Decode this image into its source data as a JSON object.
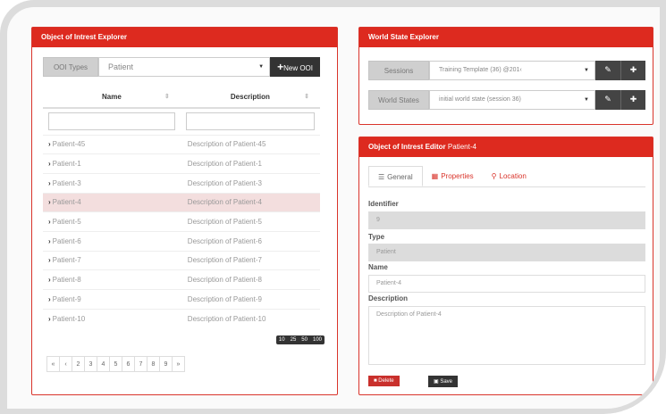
{
  "ooi_explorer": {
    "title": "Object of Intrest Explorer",
    "type_label": "OOI Types",
    "type_value": "Patient",
    "new_button": "New OOI",
    "columns": [
      "Name",
      "Description"
    ],
    "rows": [
      {
        "name": "Patient-45",
        "desc": "Description of Patient-45"
      },
      {
        "name": "Patient-1",
        "desc": "Description of Patient-1"
      },
      {
        "name": "Patient-3",
        "desc": "Description of Patient-3"
      },
      {
        "name": "Patient-4",
        "desc": "Description of Patient-4"
      },
      {
        "name": "Patient-5",
        "desc": "Description of Patient-5"
      },
      {
        "name": "Patient-6",
        "desc": "Description of Patient-6"
      },
      {
        "name": "Patient-7",
        "desc": "Description of Patient-7"
      },
      {
        "name": "Patient-8",
        "desc": "Description of Patient-8"
      },
      {
        "name": "Patient-9",
        "desc": "Description of Patient-9"
      },
      {
        "name": "Patient-10",
        "desc": "Description of Patient-10"
      }
    ],
    "page_sizes": [
      "10",
      "25",
      "50",
      "100"
    ],
    "pager": [
      "«",
      "‹",
      "2",
      "3",
      "4",
      "5",
      "6",
      "7",
      "8",
      "9",
      "»"
    ]
  },
  "world_state": {
    "title": "World State Explorer",
    "sessions_label": "Sessions",
    "sessions_value": "Training Template (36) @201‹",
    "world_states_label": "World States",
    "world_states_value": "initial world state (session 36)"
  },
  "ooi_editor": {
    "title": "Object of Intrest Editor",
    "title_accent": "Patient-4",
    "tabs": [
      "General",
      "Properties",
      "Location"
    ],
    "identifier_label": "Identifier",
    "identifier_value": "9",
    "type_label": "Type",
    "type_value": "Patient",
    "name_label": "Name",
    "name_value": "Patient-4",
    "description_label": "Description",
    "description_value": "Description of Patient-4",
    "delete_label": "Delete",
    "save_label": "Save"
  },
  "colors": {
    "accent": "#dd2a1f",
    "dark": "#333333"
  }
}
